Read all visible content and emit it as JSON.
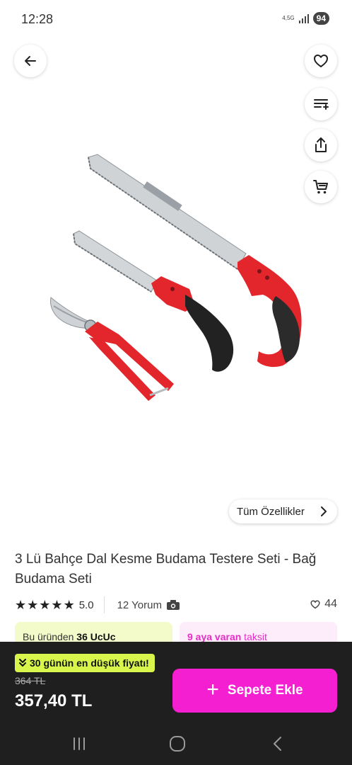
{
  "status_bar": {
    "time": "12:28",
    "network": "4,5G",
    "battery": "94",
    "icons": [
      "signal-icon",
      "battery-icon"
    ]
  },
  "actions": {
    "back_icon": "arrow-left-icon",
    "favorite_icon": "heart-icon",
    "compare_icon": "list-add-icon",
    "share_icon": "share-icon",
    "cart_icon": "cart-icon"
  },
  "features_button": {
    "label": "Tüm Özellikler",
    "icon": "chevron-right-icon"
  },
  "product": {
    "title": "3 Lü Bahçe Dal Kesme Budama Testere Seti - Bağ Budama Seti",
    "rating": "5.0",
    "star_count": 5,
    "reviews": "12 Yorum",
    "reviews_icon": "camera-icon",
    "favorites": "44",
    "favorites_icon": "heart-outline-icon"
  },
  "promos": {
    "left_prefix": "Bu üründen ",
    "left_bold": "36 UcUc",
    "right_bold": "9 aya varan",
    "right_text": " taksit"
  },
  "purchase": {
    "badge": "30 günün en düşük fiyatı!",
    "badge_icon": "double-chevron-down-icon",
    "old_price": "364 TL",
    "price": "357,40 TL",
    "add_to_cart": "Sepete Ekle",
    "add_icon": "plus-icon"
  },
  "colors": {
    "accent": "#f41fd0",
    "badge": "#d7f54a",
    "bottom_bar": "#1f1f1f",
    "promo_left_bg": "#f2fbc9",
    "promo_right_bg": "#fdecf9"
  },
  "system_nav": {
    "icons": [
      "recent-apps-icon",
      "home-icon",
      "back-nav-icon"
    ]
  }
}
